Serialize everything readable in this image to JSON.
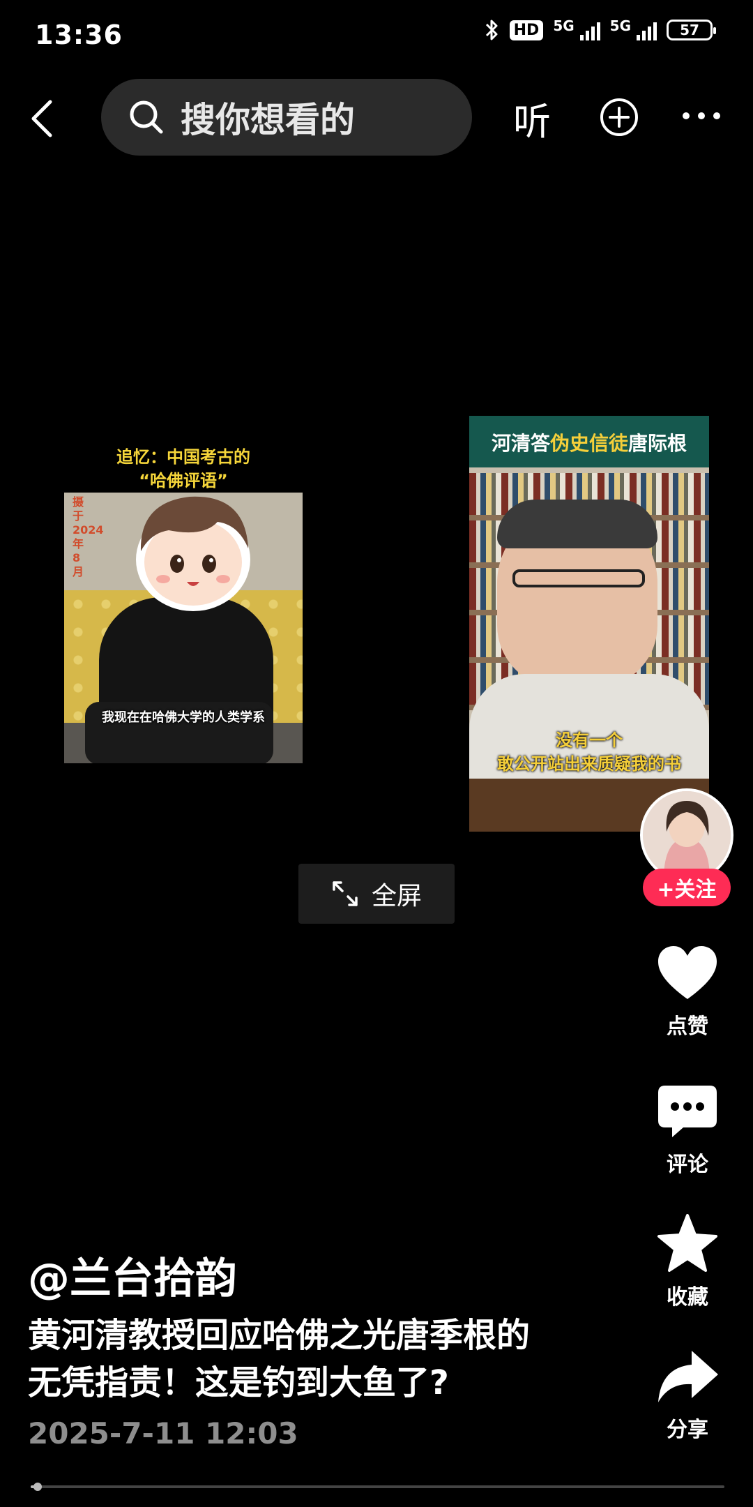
{
  "status_bar": {
    "time": "13:36",
    "hd": "HD",
    "network_1": "5G",
    "network_2": "5G",
    "battery": "57"
  },
  "top_nav": {
    "search_placeholder": "搜你想看的",
    "listen_label": "听"
  },
  "video": {
    "left_title_line1": "追忆：中国考古的",
    "left_title_line2": "“哈佛评语”",
    "left_date": "摄于2024年8月",
    "left_caption": "我现在在哈佛大学的人类学系",
    "right_title_a": "河清答",
    "right_title_b": "伪史信徒",
    "right_title_c": "唐际根",
    "right_caption_line1": "没有一个",
    "right_caption_line2": "敢公开站出来质疑我的书",
    "fullscreen_label": "全屏"
  },
  "actions": {
    "follow_label": "+关注",
    "like_label": "点赞",
    "comment_label": "评论",
    "favorite_label": "收藏",
    "share_label": "分享"
  },
  "post": {
    "author": "@兰台拾韵",
    "description_line1": "黄河清教授回应哈佛之光唐季根的",
    "description_line2": "无凭指责！这是钓到大鱼了?",
    "timestamp": "2025-7-11 12:03",
    "progress": 0.01
  },
  "colors": {
    "accent": "#fe2c55",
    "highlight": "#f5cf3a"
  }
}
